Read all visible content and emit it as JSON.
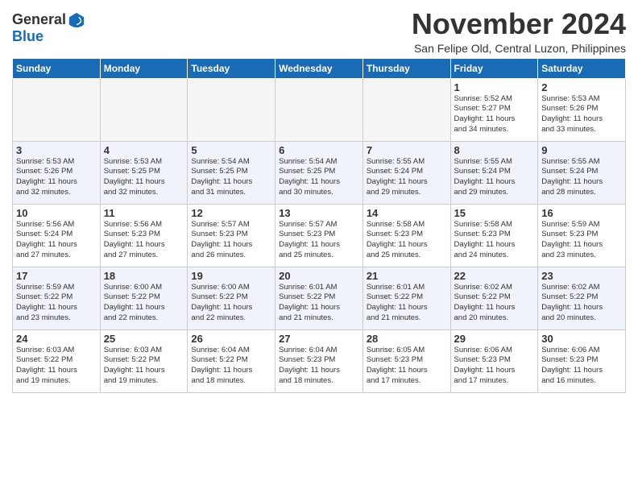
{
  "header": {
    "logo_line1": "General",
    "logo_line2": "Blue",
    "title": "November 2024",
    "location": "San Felipe Old, Central Luzon, Philippines"
  },
  "days_of_week": [
    "Sunday",
    "Monday",
    "Tuesday",
    "Wednesday",
    "Thursday",
    "Friday",
    "Saturday"
  ],
  "weeks": [
    [
      {
        "day": "",
        "info": ""
      },
      {
        "day": "",
        "info": ""
      },
      {
        "day": "",
        "info": ""
      },
      {
        "day": "",
        "info": ""
      },
      {
        "day": "",
        "info": ""
      },
      {
        "day": "1",
        "info": "Sunrise: 5:52 AM\nSunset: 5:27 PM\nDaylight: 11 hours\nand 34 minutes."
      },
      {
        "day": "2",
        "info": "Sunrise: 5:53 AM\nSunset: 5:26 PM\nDaylight: 11 hours\nand 33 minutes."
      }
    ],
    [
      {
        "day": "3",
        "info": "Sunrise: 5:53 AM\nSunset: 5:26 PM\nDaylight: 11 hours\nand 32 minutes."
      },
      {
        "day": "4",
        "info": "Sunrise: 5:53 AM\nSunset: 5:25 PM\nDaylight: 11 hours\nand 32 minutes."
      },
      {
        "day": "5",
        "info": "Sunrise: 5:54 AM\nSunset: 5:25 PM\nDaylight: 11 hours\nand 31 minutes."
      },
      {
        "day": "6",
        "info": "Sunrise: 5:54 AM\nSunset: 5:25 PM\nDaylight: 11 hours\nand 30 minutes."
      },
      {
        "day": "7",
        "info": "Sunrise: 5:55 AM\nSunset: 5:24 PM\nDaylight: 11 hours\nand 29 minutes."
      },
      {
        "day": "8",
        "info": "Sunrise: 5:55 AM\nSunset: 5:24 PM\nDaylight: 11 hours\nand 29 minutes."
      },
      {
        "day": "9",
        "info": "Sunrise: 5:55 AM\nSunset: 5:24 PM\nDaylight: 11 hours\nand 28 minutes."
      }
    ],
    [
      {
        "day": "10",
        "info": "Sunrise: 5:56 AM\nSunset: 5:24 PM\nDaylight: 11 hours\nand 27 minutes."
      },
      {
        "day": "11",
        "info": "Sunrise: 5:56 AM\nSunset: 5:23 PM\nDaylight: 11 hours\nand 27 minutes."
      },
      {
        "day": "12",
        "info": "Sunrise: 5:57 AM\nSunset: 5:23 PM\nDaylight: 11 hours\nand 26 minutes."
      },
      {
        "day": "13",
        "info": "Sunrise: 5:57 AM\nSunset: 5:23 PM\nDaylight: 11 hours\nand 25 minutes."
      },
      {
        "day": "14",
        "info": "Sunrise: 5:58 AM\nSunset: 5:23 PM\nDaylight: 11 hours\nand 25 minutes."
      },
      {
        "day": "15",
        "info": "Sunrise: 5:58 AM\nSunset: 5:23 PM\nDaylight: 11 hours\nand 24 minutes."
      },
      {
        "day": "16",
        "info": "Sunrise: 5:59 AM\nSunset: 5:23 PM\nDaylight: 11 hours\nand 23 minutes."
      }
    ],
    [
      {
        "day": "17",
        "info": "Sunrise: 5:59 AM\nSunset: 5:22 PM\nDaylight: 11 hours\nand 23 minutes."
      },
      {
        "day": "18",
        "info": "Sunrise: 6:00 AM\nSunset: 5:22 PM\nDaylight: 11 hours\nand 22 minutes."
      },
      {
        "day": "19",
        "info": "Sunrise: 6:00 AM\nSunset: 5:22 PM\nDaylight: 11 hours\nand 22 minutes."
      },
      {
        "day": "20",
        "info": "Sunrise: 6:01 AM\nSunset: 5:22 PM\nDaylight: 11 hours\nand 21 minutes."
      },
      {
        "day": "21",
        "info": "Sunrise: 6:01 AM\nSunset: 5:22 PM\nDaylight: 11 hours\nand 21 minutes."
      },
      {
        "day": "22",
        "info": "Sunrise: 6:02 AM\nSunset: 5:22 PM\nDaylight: 11 hours\nand 20 minutes."
      },
      {
        "day": "23",
        "info": "Sunrise: 6:02 AM\nSunset: 5:22 PM\nDaylight: 11 hours\nand 20 minutes."
      }
    ],
    [
      {
        "day": "24",
        "info": "Sunrise: 6:03 AM\nSunset: 5:22 PM\nDaylight: 11 hours\nand 19 minutes."
      },
      {
        "day": "25",
        "info": "Sunrise: 6:03 AM\nSunset: 5:22 PM\nDaylight: 11 hours\nand 19 minutes."
      },
      {
        "day": "26",
        "info": "Sunrise: 6:04 AM\nSunset: 5:22 PM\nDaylight: 11 hours\nand 18 minutes."
      },
      {
        "day": "27",
        "info": "Sunrise: 6:04 AM\nSunset: 5:23 PM\nDaylight: 11 hours\nand 18 minutes."
      },
      {
        "day": "28",
        "info": "Sunrise: 6:05 AM\nSunset: 5:23 PM\nDaylight: 11 hours\nand 17 minutes."
      },
      {
        "day": "29",
        "info": "Sunrise: 6:06 AM\nSunset: 5:23 PM\nDaylight: 11 hours\nand 17 minutes."
      },
      {
        "day": "30",
        "info": "Sunrise: 6:06 AM\nSunset: 5:23 PM\nDaylight: 11 hours\nand 16 minutes."
      }
    ]
  ]
}
